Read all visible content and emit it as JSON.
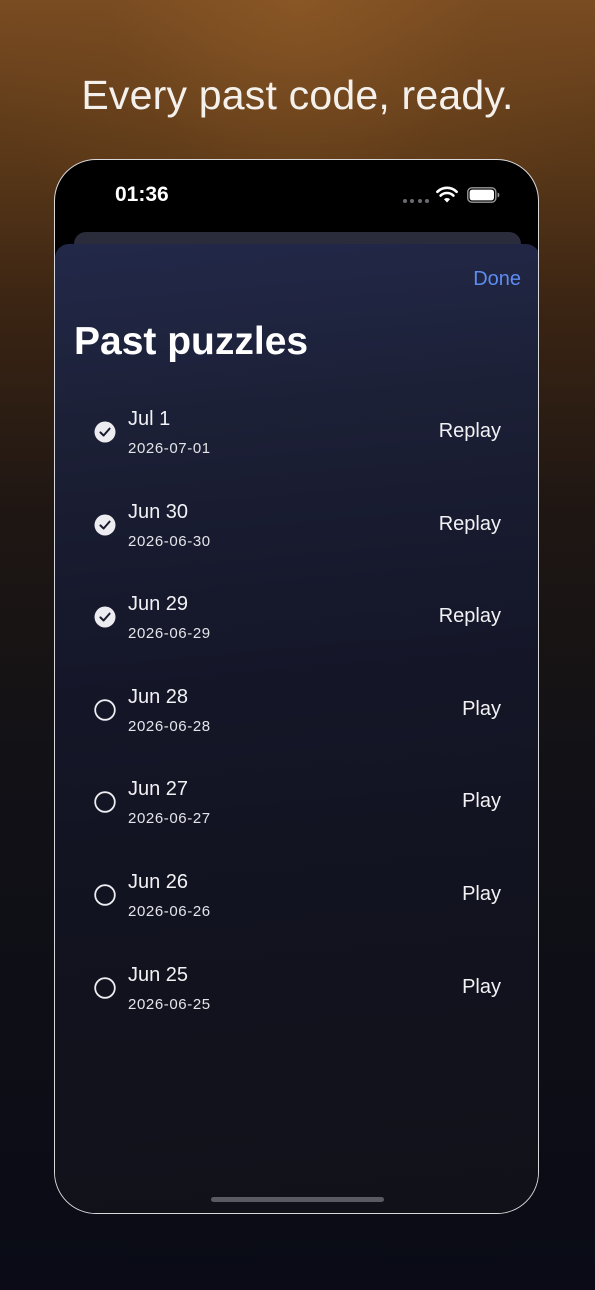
{
  "headline": "Every past code, ready.",
  "status_bar": {
    "time": "01:36",
    "icons": [
      "signal-dots-icon",
      "wifi-icon",
      "battery-icon"
    ]
  },
  "sheet": {
    "done_label": "Done",
    "title": "Past puzzles"
  },
  "puzzles": [
    {
      "title": "Jul 1",
      "date": "2026-07-01",
      "action": "Replay",
      "completed": true
    },
    {
      "title": "Jun 30",
      "date": "2026-06-30",
      "action": "Replay",
      "completed": true
    },
    {
      "title": "Jun 29",
      "date": "2026-06-29",
      "action": "Replay",
      "completed": true
    },
    {
      "title": "Jun 28",
      "date": "2026-06-28",
      "action": "Play",
      "completed": false
    },
    {
      "title": "Jun 27",
      "date": "2026-06-27",
      "action": "Play",
      "completed": false
    },
    {
      "title": "Jun 26",
      "date": "2026-06-26",
      "action": "Play",
      "completed": false
    },
    {
      "title": "Jun 25",
      "date": "2026-06-25",
      "action": "Play",
      "completed": false
    }
  ],
  "colors": {
    "accent": "#5e8bf0",
    "text": "#f2f2f5"
  }
}
